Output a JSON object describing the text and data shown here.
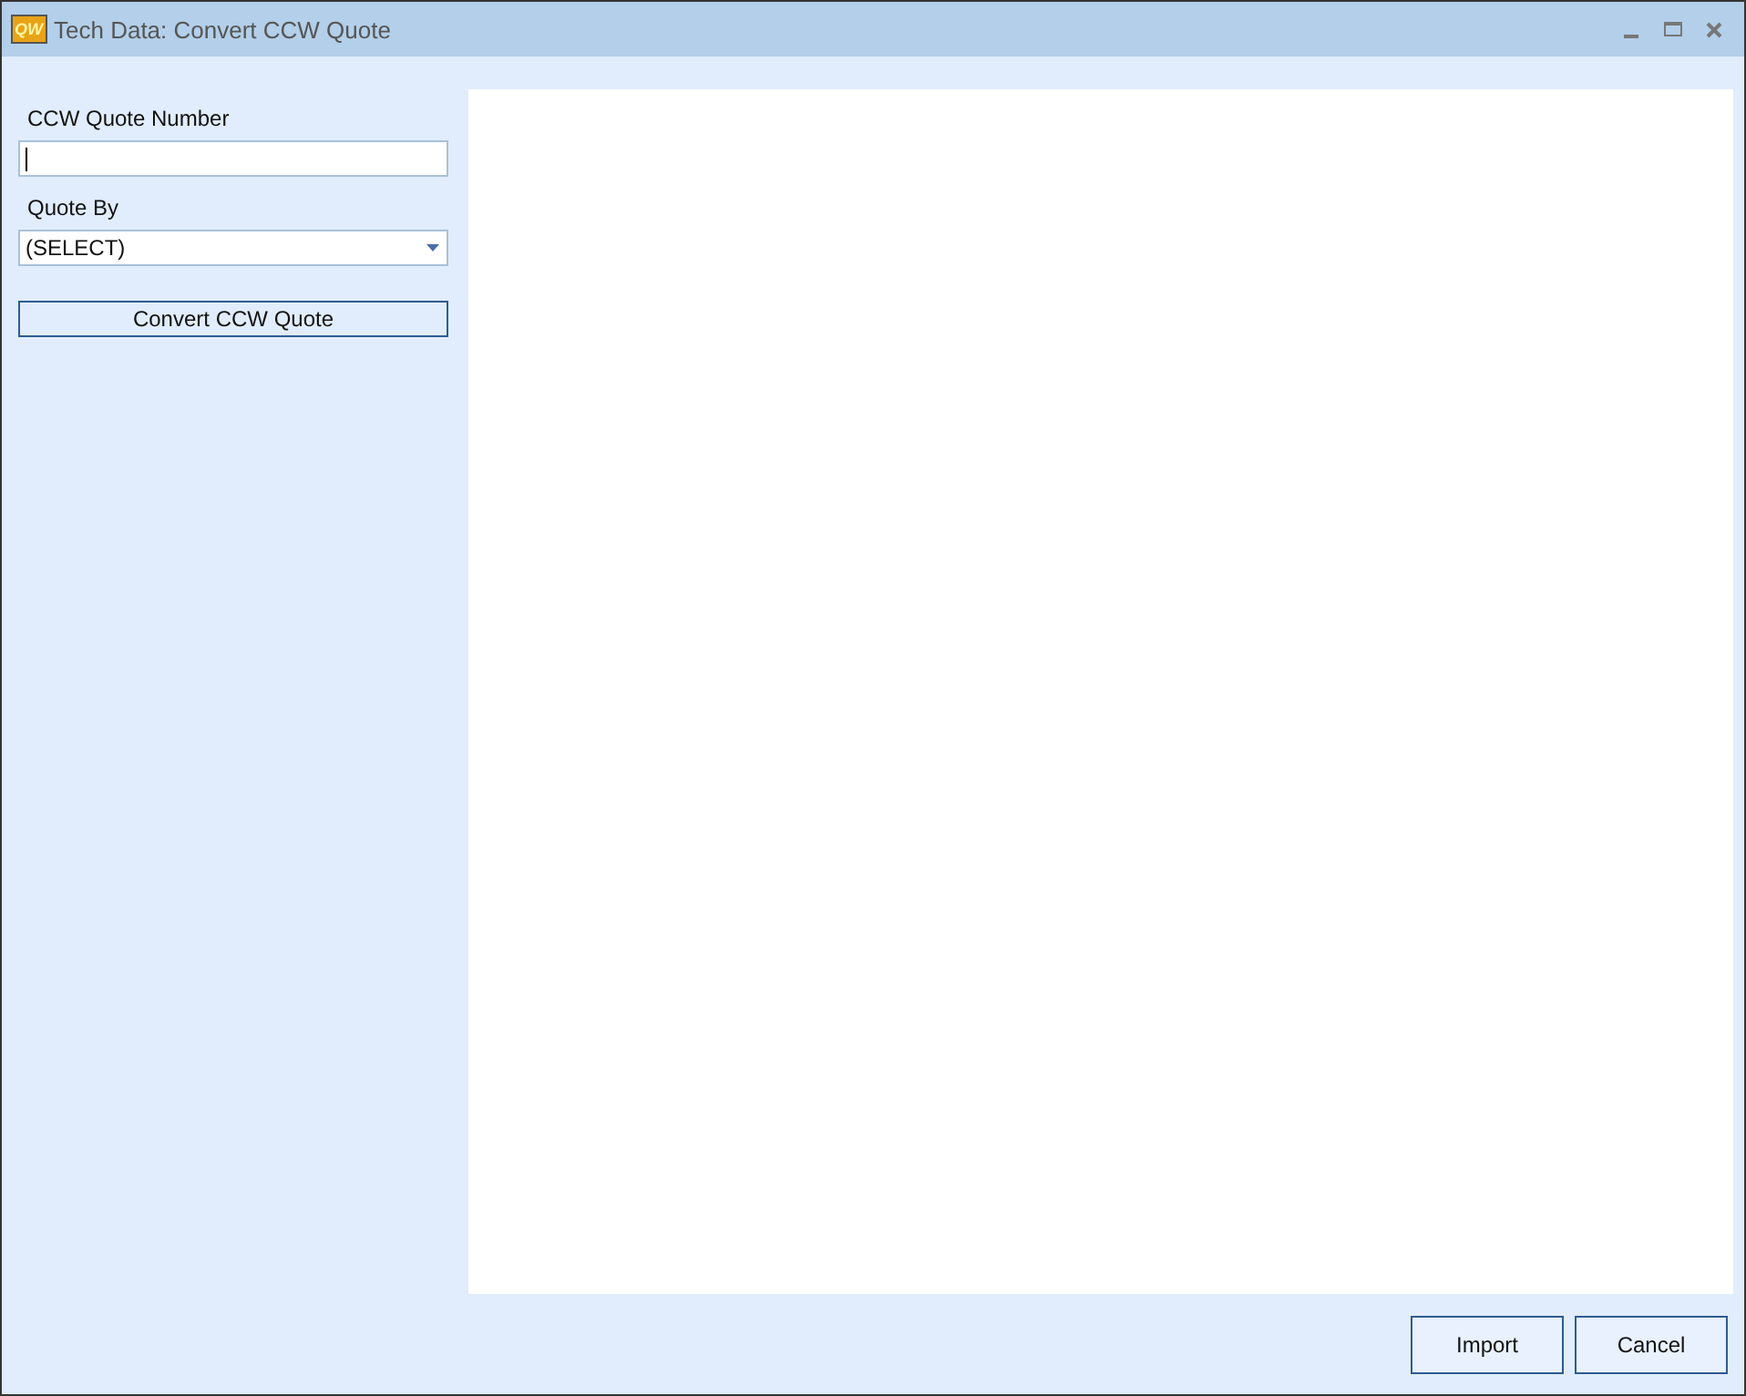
{
  "window": {
    "title": "Tech Data: Convert CCW Quote",
    "app_icon": "QW"
  },
  "form": {
    "quote_number": {
      "label": "CCW Quote Number"
    },
    "quote_by": {
      "label": "Quote By",
      "value": "(SELECT)"
    },
    "convert_button": "Convert CCW Quote"
  },
  "buttons": [
    "Import",
    "Cancel"
  ]
}
